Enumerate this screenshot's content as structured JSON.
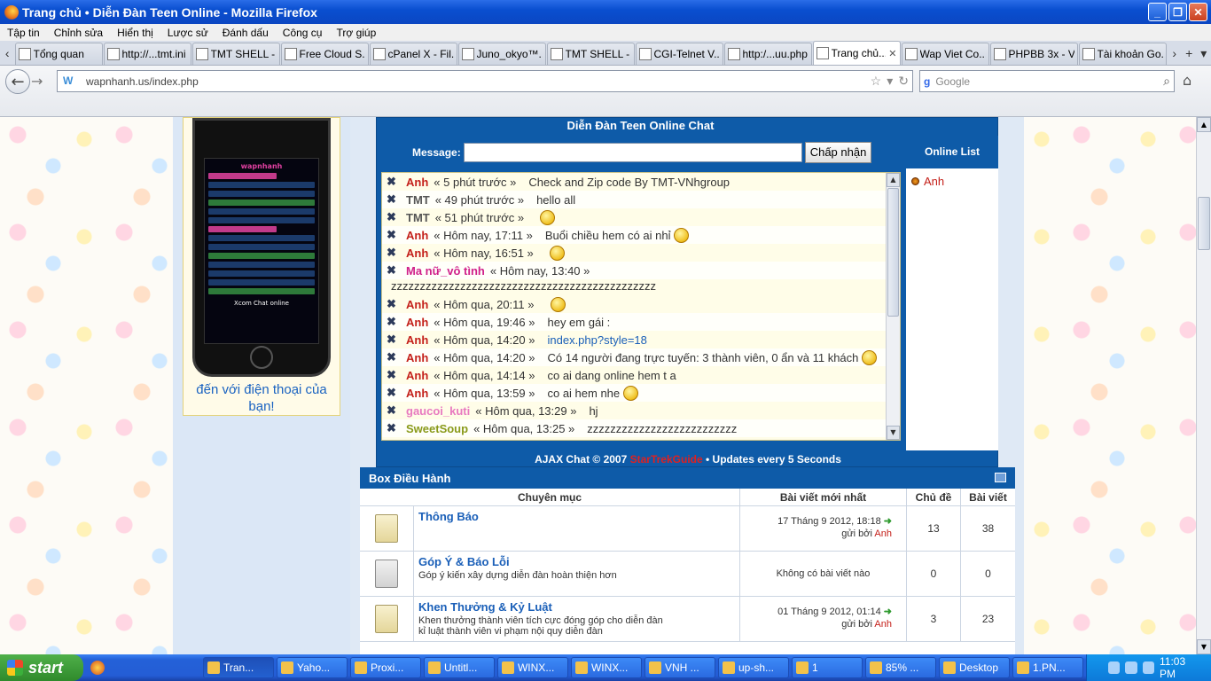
{
  "window": {
    "title": "Trang chủ • Diễn Đàn Teen Online - Mozilla Firefox"
  },
  "menu": [
    "Tập tin",
    "Chỉnh sửa",
    "Hiển thị",
    "Lược sử",
    "Đánh dấu",
    "Công cụ",
    "Trợ giúp"
  ],
  "tabs": [
    {
      "label": "Tổng quan",
      "icon": "page-icon"
    },
    {
      "label": "http://...tmt.ini",
      "icon": "page-icon"
    },
    {
      "label": "TMT SHELL - ...",
      "icon": "page-icon"
    },
    {
      "label": "Free Cloud S...",
      "icon": "cloud-icon"
    },
    {
      "label": "cPanel X - Fil...",
      "icon": "cpanel-icon"
    },
    {
      "label": "Juno_okyo™...",
      "icon": "page-icon"
    },
    {
      "label": "TMT SHELL - ...",
      "icon": "page-icon"
    },
    {
      "label": "CGI-Telnet V...",
      "icon": "page-icon"
    },
    {
      "label": "http:/...uu.php",
      "icon": "page-icon"
    },
    {
      "label": "Trang chủ...",
      "icon": "site-icon",
      "active": true
    },
    {
      "label": "Wap Viet Co...",
      "icon": "site-icon"
    },
    {
      "label": "PHPBB 3x - Vi...",
      "icon": "page-icon"
    },
    {
      "label": "Tài khoản Go...",
      "icon": "google-icon"
    }
  ],
  "nav": {
    "url": "wapnhanh.us/index.php",
    "search_placeholder": "Google",
    "search_engine": "g"
  },
  "phone": {
    "caption": "đến với điện thoại của bạn!",
    "screen_title": "wapnhanh",
    "screen_footer": "Xcom Chat online"
  },
  "chat": {
    "title": "Diễn Đàn Teen Online Chat",
    "message_label": "Message:",
    "message_value": "",
    "submit_label": "Chấp nhận",
    "online_title": "Online List",
    "online_users": [
      "Anh"
    ],
    "footer_prefix": "AJAX Chat © 2007 ",
    "footer_link": "StarTrekGuide",
    "footer_suffix": " • Updates every 5 Seconds",
    "rows": [
      {
        "name": "Anh",
        "color": "#c4201a",
        "time": "« 5 phút trước »",
        "text": "Check and Zip code By TMT-VNhgroup",
        "smiley": false
      },
      {
        "name": "TMT",
        "color": "#555555",
        "time": "« 49 phút trước »",
        "text": "hello all",
        "smiley": false
      },
      {
        "name": "TMT",
        "color": "#555555",
        "time": "« 51 phút trước »",
        "text": "",
        "smiley": true
      },
      {
        "name": "Anh",
        "color": "#c4201a",
        "time": "« Hôm nay, 17:11 »",
        "text": "Buổi chiều hem có ai nhỉ",
        "smiley": true
      },
      {
        "name": "Anh",
        "color": "#c4201a",
        "time": "« Hôm nay, 16:51 »",
        "text": "",
        "smiley": true
      },
      {
        "name": "Ma nữ_vô tình",
        "color": "#d0208a",
        "time": "« Hôm nay, 13:40 »",
        "text": "",
        "smiley": false,
        "wrap": "zzzzzzzzzzzzzzzzzzzzzzzzzzzzzzzzzzzzzzzzzzzzzz"
      },
      {
        "name": "Anh",
        "color": "#c4201a",
        "time": "« Hôm qua, 20:11 »",
        "text": "",
        "smiley": true
      },
      {
        "name": "Anh",
        "color": "#c4201a",
        "time": "« Hôm qua, 19:46 »",
        "text": "hey em gái :",
        "smiley": false
      },
      {
        "name": "Anh",
        "color": "#c4201a",
        "time": "« Hôm qua, 14:20 »",
        "text": "index.php?style=18",
        "smiley": false,
        "link": true
      },
      {
        "name": "Anh",
        "color": "#c4201a",
        "time": "« Hôm qua, 14:20 »",
        "text": "Có 14 người đang trực tuyến: 3 thành viên, 0 ẩn và 11 khách",
        "smiley": true
      },
      {
        "name": "Anh",
        "color": "#c4201a",
        "time": "« Hôm qua, 14:14 »",
        "text": "co ai dang online hem t a",
        "smiley": false
      },
      {
        "name": "Anh",
        "color": "#c4201a",
        "time": "« Hôm qua, 13:59 »",
        "text": "co ai hem nhe",
        "smiley": true
      },
      {
        "name": "gaucoi_kuti",
        "color": "#e87ac0",
        "time": "« Hôm qua, 13:29 »",
        "text": "hj",
        "smiley": false
      },
      {
        "name": "SweetSoup",
        "color": "#8a9a1a",
        "time": "« Hôm qua, 13:25 »",
        "text": "zzzzzzzzzzzzzzzzzzzzzzzzzz",
        "smiley": false
      }
    ]
  },
  "forum": {
    "title": "Box Điều Hành",
    "columns": [
      "Chuyên mục",
      "Bài viết mới nhất",
      "Chủ đề",
      "Bài viết"
    ],
    "rows": [
      {
        "title": "Thông Báo",
        "desc": "",
        "desc2": "",
        "last": "17 Tháng 9 2012, 18:18",
        "by_label": "gửi bởi ",
        "by": "Anh",
        "topics": "13",
        "posts": "38",
        "icon": "folder-icon"
      },
      {
        "title": "Góp Ý & Báo Lỗi",
        "desc": "Góp ý kiến xây dựng diễn đàn hoàn thiện hơn",
        "desc2": "",
        "last": "Không có bài viết nào",
        "by_label": "",
        "by": "",
        "topics": "0",
        "posts": "0",
        "icon": "folder-empty-icon"
      },
      {
        "title": "Khen Thưởng & Kỷ Luật",
        "desc": "Khen thưởng thành viên tích cực đóng góp cho diễn đàn",
        "desc2": "kỉ luật thành viên vi phạm nội quy diễn đàn",
        "last": "01 Tháng 9 2012, 01:14",
        "by_label": "gửi bởi ",
        "by": "Anh",
        "topics": "3",
        "posts": "23",
        "icon": "folder-icon"
      }
    ]
  },
  "taskbar": {
    "start_label": "start",
    "tasks": [
      "Tran...",
      "Yaho...",
      "Proxi...",
      "Untitl...",
      "WINX...",
      "WINX...",
      "VNH ...",
      "up-sh...",
      "1",
      "85% ...",
      "Desktop",
      "1.PN..."
    ],
    "clock": "11:03 PM"
  }
}
